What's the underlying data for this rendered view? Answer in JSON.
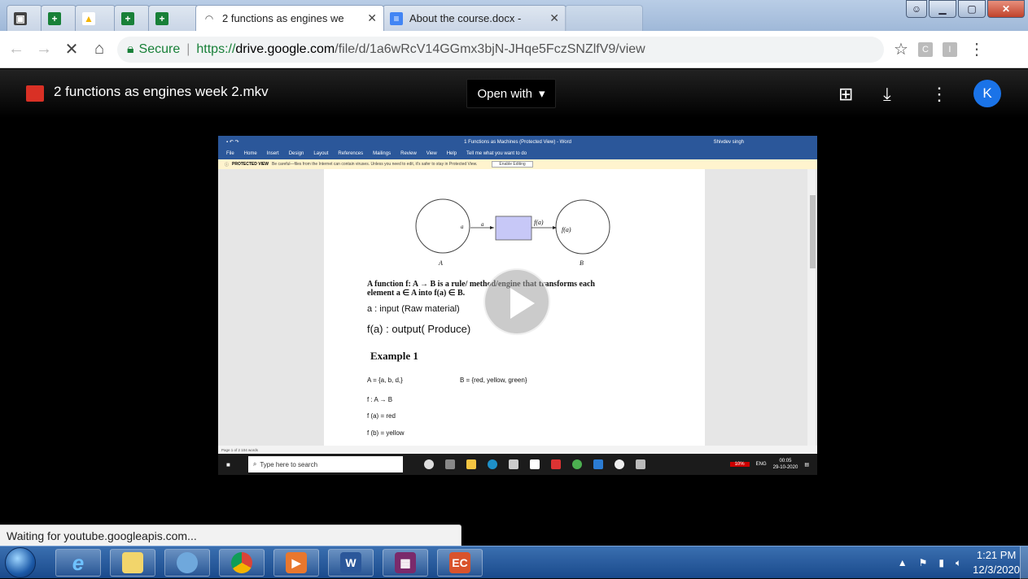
{
  "browser": {
    "tabs": [
      {
        "label": "",
        "icon": "photos-icon",
        "color": "#444"
      },
      {
        "label": "",
        "icon": "sheets-icon",
        "color": "#188038"
      },
      {
        "label": "",
        "icon": "drive-icon",
        "color": "#f4b400"
      },
      {
        "label": "",
        "icon": "sheets-icon",
        "color": "#188038"
      },
      {
        "label": "",
        "icon": "sheets-icon",
        "color": "#188038"
      },
      {
        "label": "2 functions as engines we",
        "icon": "loading-icon",
        "active": true
      },
      {
        "label": "About the course.docx -",
        "icon": "docs-icon",
        "color": "#4285f4"
      },
      {
        "label": "",
        "icon": "blank-icon"
      }
    ],
    "secure_label": "Secure",
    "url_proto": "https://",
    "url_host": "drive.google.com",
    "url_path": "/file/d/1a6wRcV14GGmx3bjN-JHqe5FczSNZlfV9/view"
  },
  "viewer": {
    "file_name": "2 functions as engines week 2.mkv",
    "open_with": "Open with",
    "avatar_letter": "K"
  },
  "word": {
    "title": "1 Functions as Machines (Protected View) - Word",
    "user": "Shivdev singh",
    "ribbon": [
      "File",
      "Home",
      "Insert",
      "Design",
      "Layout",
      "References",
      "Mailings",
      "Review",
      "View",
      "Help",
      "Tell me what you want to do"
    ],
    "protected_label": "PROTECTED VIEW",
    "protected_msg": "Be careful—files from the Internet can contain viruses. Unless you need to edit, it's safer to stay in Protected View.",
    "enable_editing": "Enable Editing",
    "status": "Page 1 of 2   104 words",
    "search_placeholder": "Type here to search",
    "tray_time": "00:05",
    "tray_date": "29-10-2020",
    "tray_lang": "ENG",
    "doc": {
      "diagram_a_input": "a",
      "diagram_a_arrow": "a",
      "diagram_fa_arrow": "f(a)",
      "diagram_fa_out": "f(a)",
      "set_a": "A",
      "set_b": "B",
      "def_line1": "A function f: A → B is a rule/ method/engine that transforms each",
      "def_line2": "element a ∈ A into f(a) ∈ B.",
      "input_line": "a : input (Raw material)",
      "output_line": "f(a) : output( Produce)",
      "example_heading": "Example 1",
      "set_a_def": "A = {a, b, d,}",
      "set_b_def": "B = {red, yellow, green}",
      "map_line": "f : A → B",
      "fa_line": "f (a)  =  red",
      "fb_line": "f (b)  =  yellow"
    }
  },
  "status_tip": "Waiting for youtube.googleapis.com...",
  "taskbar": {
    "time": "1:21 PM",
    "date": "12/3/2020"
  }
}
